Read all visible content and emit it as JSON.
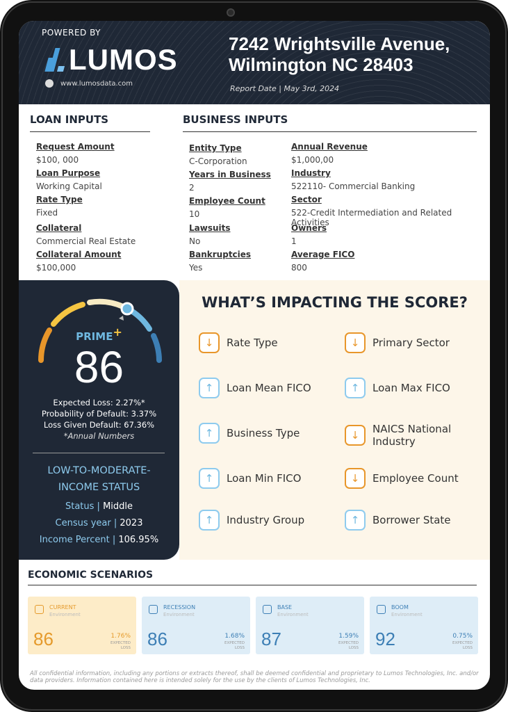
{
  "header": {
    "powered_by": "POWERED BY",
    "logo": "LUMOS",
    "website": "www.lumosdata.com",
    "address_line1": "7242 Wrightsville Avenue,",
    "address_line2": "Wilmington NC 28403",
    "report_date": "Report Date | May 3rd, 2024"
  },
  "loan_inputs": {
    "title": "LOAN INPUTS",
    "fields": [
      {
        "label": "Request Amount",
        "value": "$100, 000"
      },
      {
        "label": "Loan Purpose",
        "value": "Working Capital"
      },
      {
        "label": "Rate Type",
        "value": "Fixed"
      },
      {
        "label": "Collateral",
        "value": "Commercial Real Estate"
      },
      {
        "label": "Collateral Amount",
        "value": "$100,000"
      }
    ]
  },
  "business_inputs": {
    "title": "BUSINESS INPUTS",
    "col1": [
      {
        "label": "Entity Type",
        "value": "C-Corporation"
      },
      {
        "label": "Years in Business",
        "value": "2"
      },
      {
        "label": "Employee Count",
        "value": "10"
      },
      {
        "label": "Lawsuits",
        "value": "No"
      },
      {
        "label": "Bankruptcies",
        "value": "Yes"
      }
    ],
    "col2": [
      {
        "label": "Annual Revenue",
        "value": "$1,000,00"
      },
      {
        "label": "Industry",
        "value": "522110- Commercial Banking"
      },
      {
        "label": "Sector",
        "value": "522-Credit Intermediation and Related Activities"
      },
      {
        "label": "Owners",
        "value": "1"
      },
      {
        "label": "Average FICO",
        "value": "800"
      }
    ]
  },
  "score": {
    "tier": "PRIME",
    "tier_plus": "+",
    "value": "86",
    "gauge_fraction": 0.72,
    "expected_loss": "Expected Loss: 2.27%*",
    "pd": "Probability of Default: 3.37%",
    "lgd": "Loss Given Default: 67.36%",
    "note": "*Annual Numbers",
    "colors": {
      "orange": "#e8962a",
      "yellow": "#f5c542",
      "cream": "#f7ebc4",
      "light_blue": "#6fb8e0",
      "blue": "#3d7fb5"
    }
  },
  "lmi": {
    "title1": "LOW-TO-MODERATE-",
    "title2": "INCOME STATUS",
    "rows": [
      {
        "label": "Status",
        "value": "Middle"
      },
      {
        "label": "Census year",
        "value": "2023"
      },
      {
        "label": "Income Percent",
        "value": "106.95%"
      }
    ]
  },
  "impact": {
    "title": "WHAT’S IMPACTING THE SCORE?",
    "factors": [
      {
        "label": "Rate Type",
        "direction": "down"
      },
      {
        "label": "Primary Sector",
        "direction": "down"
      },
      {
        "label": "Loan Mean FICO",
        "direction": "up"
      },
      {
        "label": "Loan Max FICO",
        "direction": "up"
      },
      {
        "label": "Business Type",
        "direction": "up"
      },
      {
        "label": "NAICS National Industry",
        "direction": "down"
      },
      {
        "label": "Loan Min FICO",
        "direction": "up"
      },
      {
        "label": "Employee Count",
        "direction": "down"
      },
      {
        "label": "Industry Group",
        "direction": "up"
      },
      {
        "label": "Borrower State",
        "direction": "up"
      }
    ]
  },
  "economic": {
    "title": "ECONOMIC SCENARIOS",
    "env_label": "Environment",
    "el_label": "EXPECTED LOSS",
    "scenarios": [
      {
        "name": "CURRENT",
        "score": "86",
        "expected_loss": "1.76%",
        "icon": "sun-icon"
      },
      {
        "name": "RECESSION",
        "score": "86",
        "expected_loss": "1.68%",
        "icon": "chart-calendar-icon"
      },
      {
        "name": "BASE",
        "score": "87",
        "expected_loss": "1.59%",
        "icon": "chart-calendar-icon"
      },
      {
        "name": "BOOM",
        "score": "92",
        "expected_loss": "0.75%",
        "icon": "chart-calendar-icon"
      }
    ]
  },
  "disclaimer": "All confidential information, including any portions or extracts thereof, shall be deemed confidential and proprietary to Lumos Technologies, Inc. and/or data providers. Information contained here is intended solely for the use by the clients of Lumos Technologies, Inc."
}
